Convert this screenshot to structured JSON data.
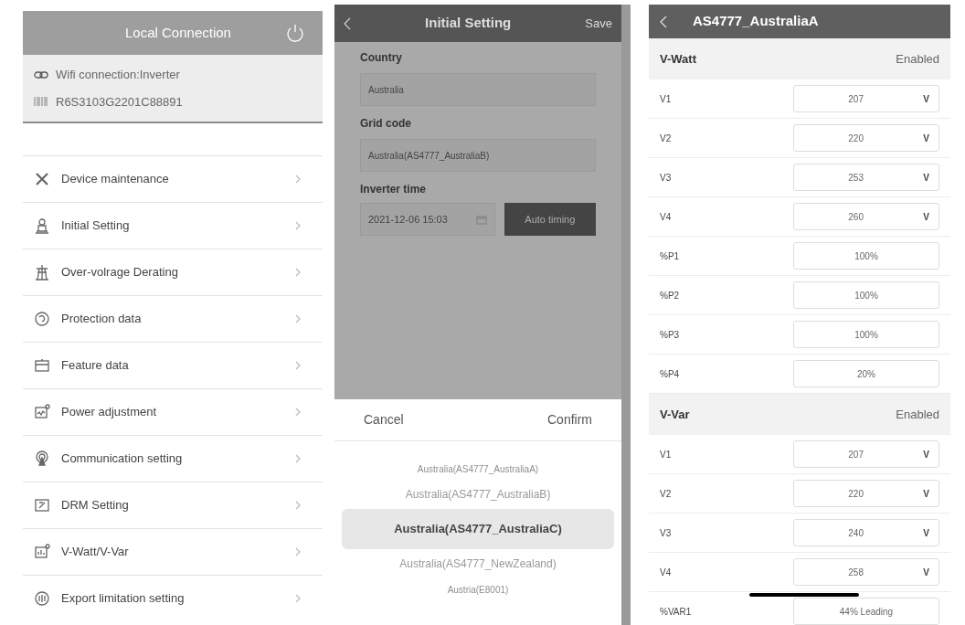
{
  "local_connection": {
    "title": "Local Connection",
    "wifi": "Wifi connection:Inverter",
    "serial": "R6S3103G2201C88891",
    "menu": [
      {
        "label": "Device maintenance"
      },
      {
        "label": "Initial Setting"
      },
      {
        "label": "Over-volrage Derating"
      },
      {
        "label": "Protection data"
      },
      {
        "label": "Feature data"
      },
      {
        "label": "Power adjustment"
      },
      {
        "label": "Communication setting"
      },
      {
        "label": "DRM Setting"
      },
      {
        "label": "V-Watt/V-Var"
      },
      {
        "label": "Export limitation setting"
      }
    ]
  },
  "initial_setting": {
    "title": "Initial Setting",
    "save": "Save",
    "fields": [
      {
        "label": "Country",
        "value": "Australia"
      },
      {
        "label": "Grid code",
        "value": "Australia(AS4777_AustraliaB)"
      }
    ],
    "time": {
      "label": "Inverter time",
      "value": "2021-12-06 15:03"
    },
    "auto_timing": "Auto timing",
    "picker": {
      "cancel": "Cancel",
      "confirm": "Confirm",
      "options": [
        {
          "label": "Australia(AS4777_AustraliaA)",
          "selected": false
        },
        {
          "label": "Australia(AS4777_AustraliaB)",
          "selected": false
        },
        {
          "label": "Australia(AS4777_AustraliaC)",
          "selected": true
        },
        {
          "label": "Australia(AS4777_NewZealand)",
          "selected": false
        },
        {
          "label": "Austria(E8001)",
          "selected": false
        }
      ]
    }
  },
  "vwatt": {
    "title": "AS4777_AustraliaA",
    "sections": [
      {
        "title": "V-Watt",
        "status": "Enabled",
        "rows": [
          {
            "label": "V1",
            "value": "207",
            "unit": "V"
          },
          {
            "label": "V2",
            "value": "220",
            "unit": "V"
          },
          {
            "label": "V3",
            "value": "253",
            "unit": "V"
          },
          {
            "label": "V4",
            "value": "260",
            "unit": "V"
          },
          {
            "label": "%P1",
            "value": "100%"
          },
          {
            "label": "%P2",
            "value": "100%"
          },
          {
            "label": "%P3",
            "value": "100%"
          },
          {
            "label": "%P4",
            "value": "20%"
          }
        ]
      },
      {
        "title": "V-Var",
        "status": "Enabled",
        "rows": [
          {
            "label": "V1",
            "value": "207",
            "unit": "V"
          },
          {
            "label": "V2",
            "value": "220",
            "unit": "V"
          },
          {
            "label": "V3",
            "value": "240",
            "unit": "V"
          },
          {
            "label": "V4",
            "value": "258",
            "unit": "V"
          },
          {
            "label": "%VAR1",
            "value": "44% Leading"
          }
        ]
      }
    ]
  }
}
